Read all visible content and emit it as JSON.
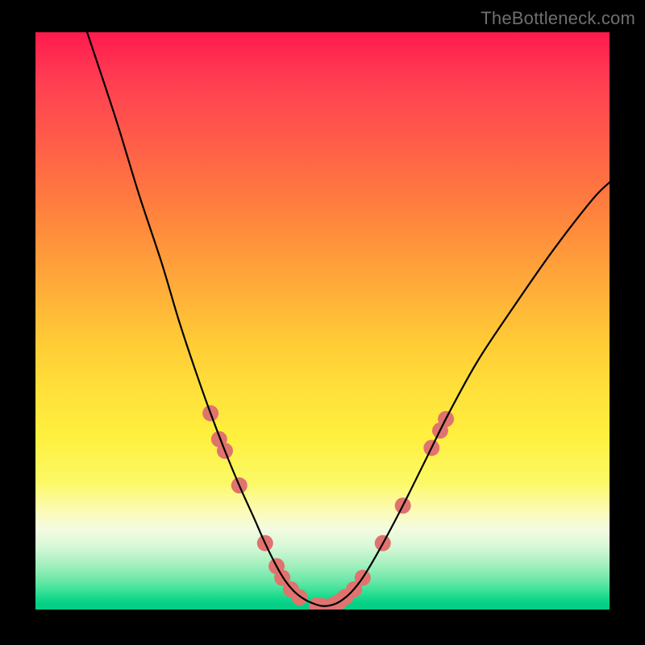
{
  "watermark": "TheBottleneck.com",
  "chart_data": {
    "type": "line",
    "title": "",
    "xlabel": "",
    "ylabel": "",
    "xlim": [
      0,
      100
    ],
    "ylim": [
      0,
      100
    ],
    "grid": false,
    "legend": false,
    "series": [
      {
        "name": "bottleneck-curve",
        "color": "#000000",
        "x": [
          9,
          14,
          18,
          22,
          25,
          28,
          30.5,
          33,
          35.5,
          38,
          40,
          42,
          43.5,
          45,
          46.5,
          48,
          50,
          52,
          53.5,
          55,
          57,
          60,
          64,
          68,
          72,
          77,
          83,
          90,
          97,
          100
        ],
        "values": [
          100,
          85,
          72,
          60,
          50,
          41,
          34,
          27.5,
          21.5,
          16,
          11.5,
          7.5,
          5,
          3.2,
          2,
          1.2,
          0.6,
          0.9,
          1.7,
          3,
          5.5,
          10.5,
          18,
          26,
          34,
          43,
          52,
          62,
          71,
          74
        ]
      }
    ],
    "markers": {
      "name": "highlight-band-points",
      "color": "#e0736e",
      "radius_px": 10,
      "points": [
        {
          "x": 30.5,
          "y": 34
        },
        {
          "x": 32,
          "y": 29.5
        },
        {
          "x": 33,
          "y": 27.5
        },
        {
          "x": 35.5,
          "y": 21.5
        },
        {
          "x": 40,
          "y": 11.5
        },
        {
          "x": 42,
          "y": 7.5
        },
        {
          "x": 43,
          "y": 5.5
        },
        {
          "x": 44.5,
          "y": 3.5
        },
        {
          "x": 46,
          "y": 2.1
        },
        {
          "x": 49,
          "y": 0.7
        },
        {
          "x": 50,
          "y": 0.6
        },
        {
          "x": 52,
          "y": 0.9
        },
        {
          "x": 53,
          "y": 1.4
        },
        {
          "x": 54,
          "y": 2.2
        },
        {
          "x": 55.5,
          "y": 3.5
        },
        {
          "x": 57,
          "y": 5.5
        },
        {
          "x": 60.5,
          "y": 11.5
        },
        {
          "x": 64,
          "y": 18
        },
        {
          "x": 69,
          "y": 28
        },
        {
          "x": 70.5,
          "y": 31
        },
        {
          "x": 71.5,
          "y": 33
        }
      ]
    },
    "gradient_colors": {
      "top": "#ff1a4d",
      "mid": "#fff03e",
      "bottom": "#04ce85"
    }
  }
}
